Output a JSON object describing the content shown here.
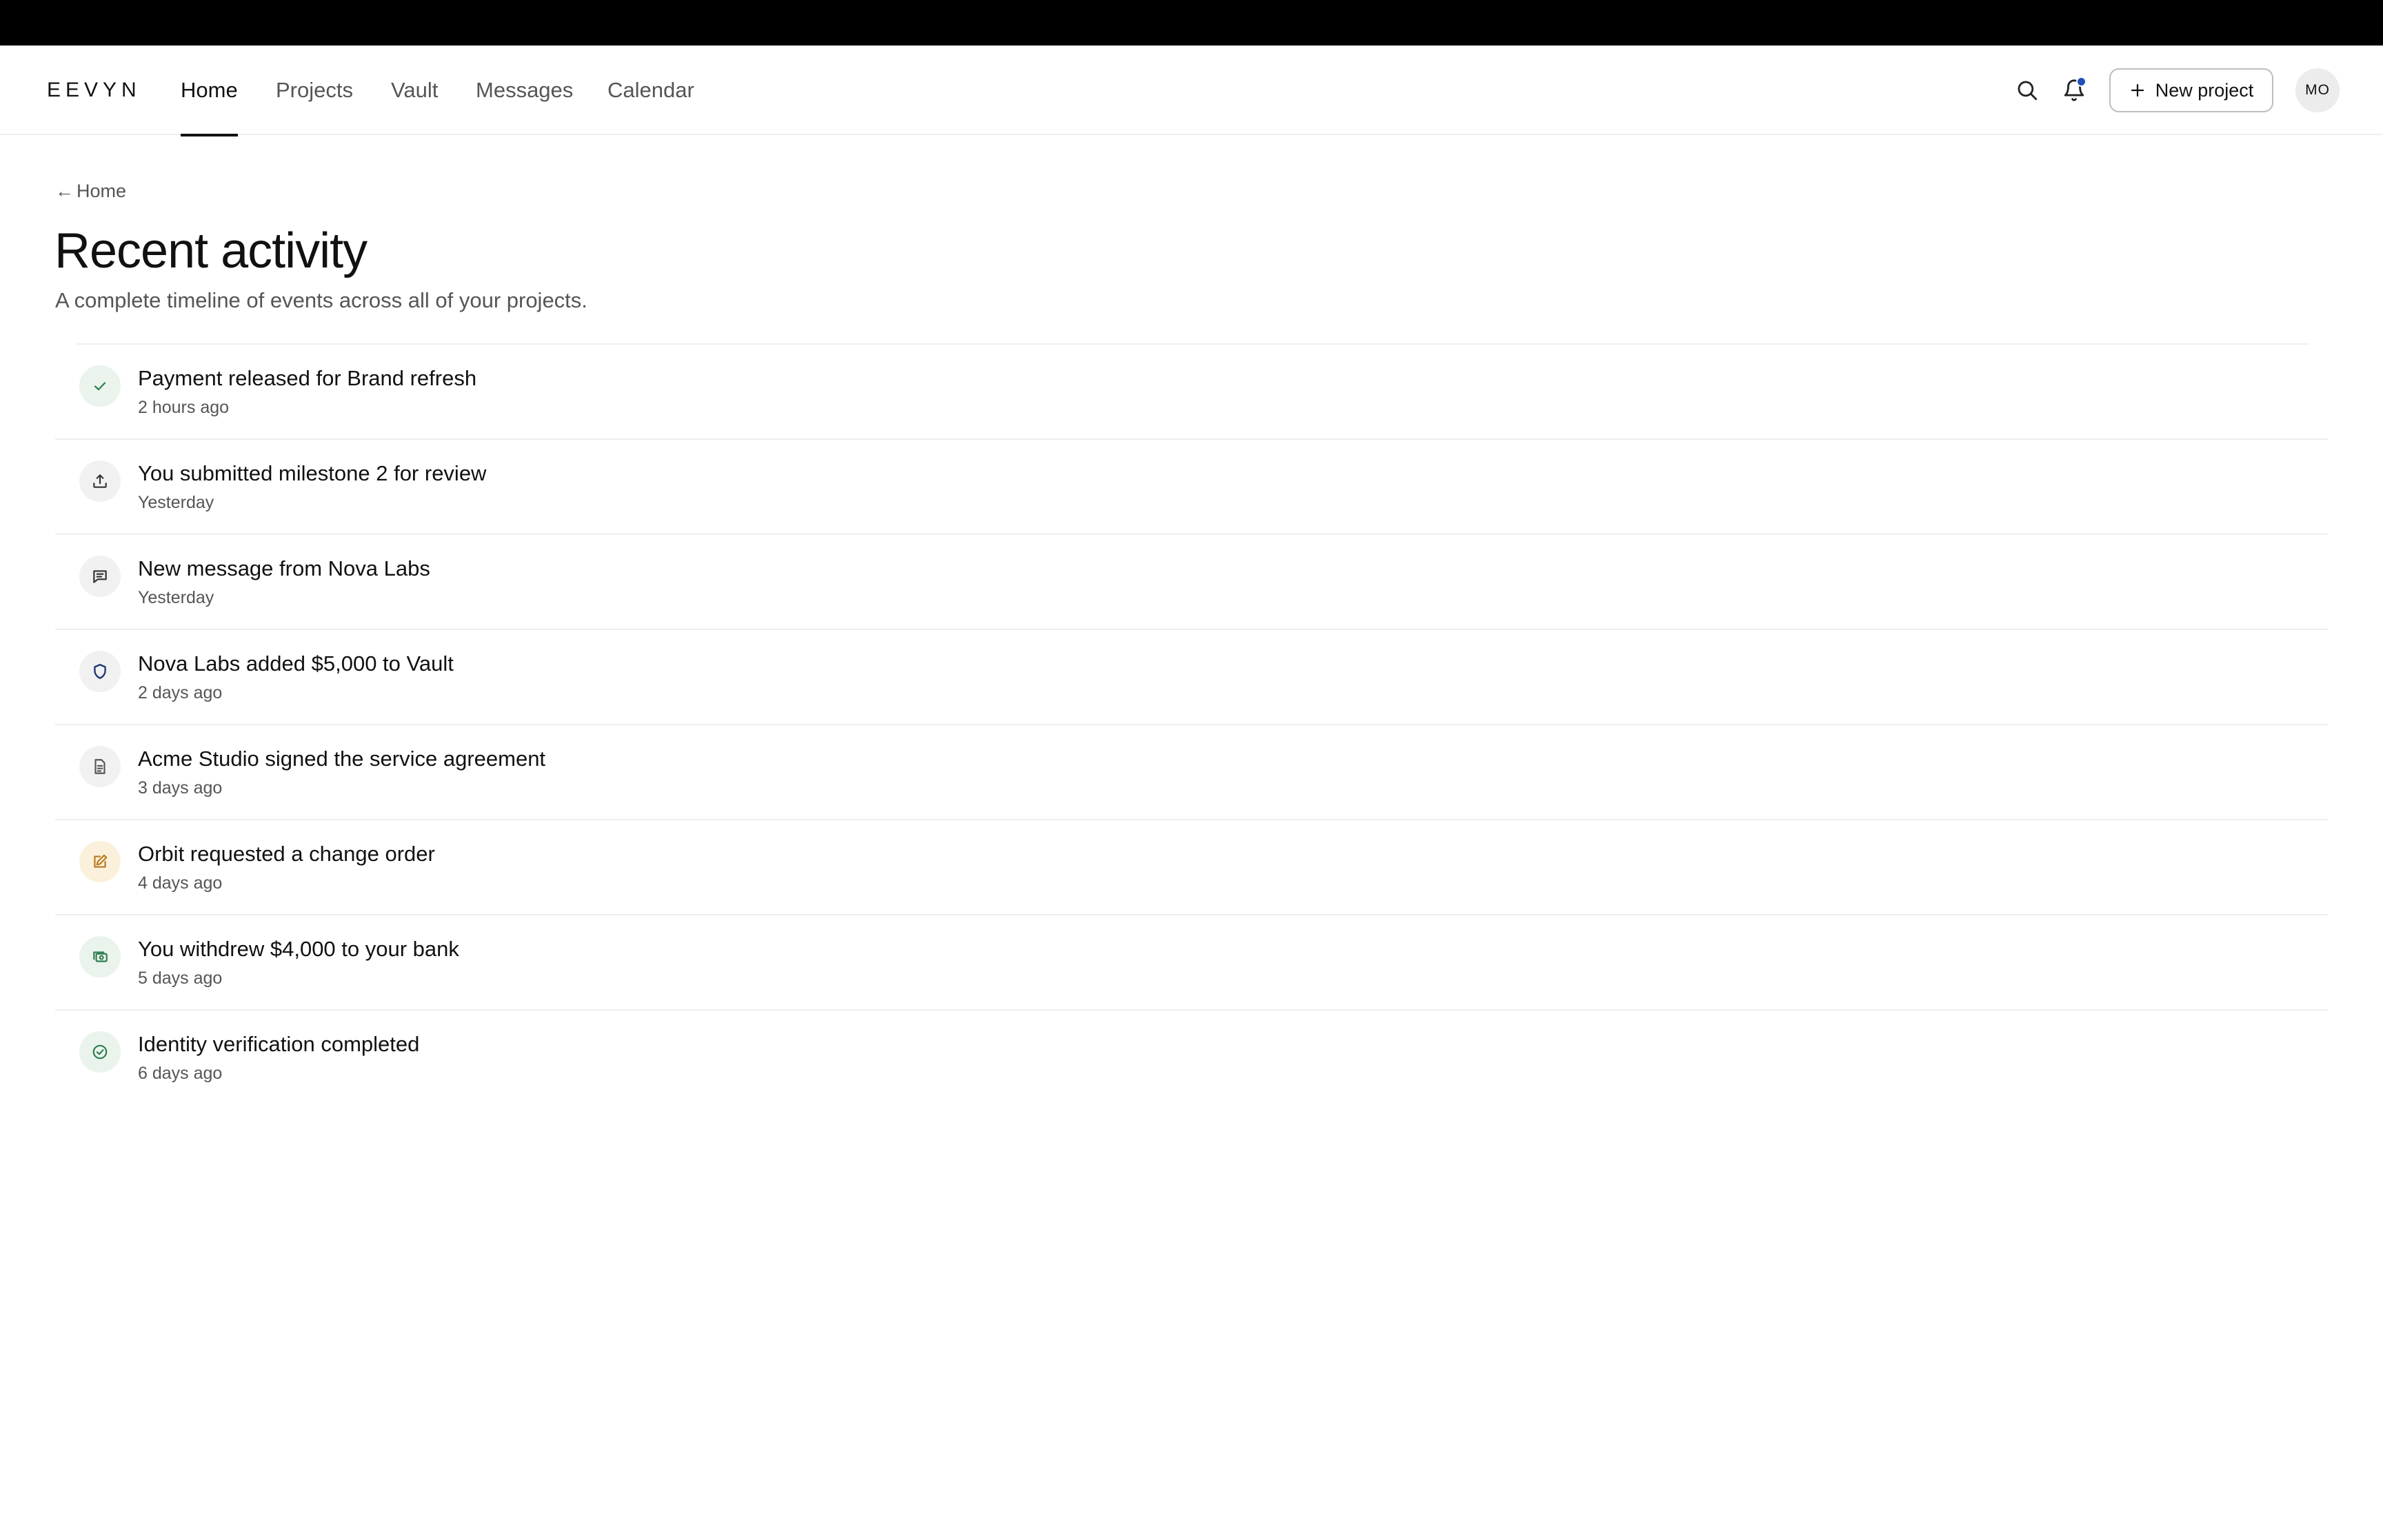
{
  "brand": "EEVYN",
  "nav": {
    "tabs": [
      {
        "label": "Home",
        "active": true
      },
      {
        "label": "Projects",
        "active": false
      },
      {
        "label": "Vault",
        "active": false
      },
      {
        "label": "Messages",
        "active": false
      },
      {
        "label": "Calendar",
        "active": false
      }
    ],
    "search_icon": "search-icon",
    "notifications_icon": "bell-icon",
    "notification_dot_color": "#1f4fb8",
    "new_project_label": "New project",
    "avatar_initials": "MO"
  },
  "breadcrumb": {
    "arrow": "←",
    "label": "Home"
  },
  "page": {
    "title": "Recent activity",
    "subtitle": "A complete timeline of events across all of your projects."
  },
  "activities": [
    {
      "title": "Payment released for Brand refresh",
      "time": "2 hours ago",
      "icon": "check-icon",
      "bg": "#eaf3ec",
      "fg": "#2e7d4f"
    },
    {
      "title": "You submitted milestone 2 for review",
      "time": "Yesterday",
      "icon": "upload-icon",
      "bg": "#f1f1f1",
      "fg": "#333333"
    },
    {
      "title": "New message from Nova Labs",
      "time": "Yesterday",
      "icon": "message-icon",
      "bg": "#f1f1f1",
      "fg": "#333333"
    },
    {
      "title": "Nova Labs added $5,000 to Vault",
      "time": "2 days ago",
      "icon": "shield-icon",
      "bg": "#f1f1f1",
      "fg": "#1f3b73"
    },
    {
      "title": "Acme Studio signed the service agreement",
      "time": "3 days ago",
      "icon": "document-icon",
      "bg": "#f1f1f1",
      "fg": "#555555"
    },
    {
      "title": "Orbit requested a change order",
      "time": "4 days ago",
      "icon": "edit-icon",
      "bg": "#fbf0dc",
      "fg": "#b8791a"
    },
    {
      "title": "You withdrew $4,000 to your bank",
      "time": "5 days ago",
      "icon": "cash-icon",
      "bg": "#eaf3ec",
      "fg": "#2e7d4f"
    },
    {
      "title": "Identity verification completed",
      "time": "6 days ago",
      "icon": "check-circle-icon",
      "bg": "#eaf3ec",
      "fg": "#2e7d4f"
    }
  ]
}
